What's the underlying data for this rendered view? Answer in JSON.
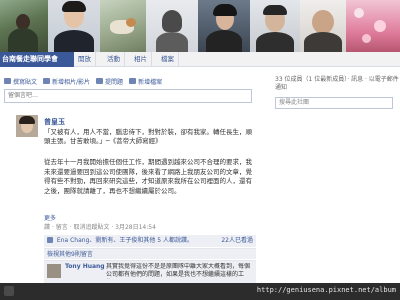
{
  "group": {
    "title": "台南餐走聯同學會"
  },
  "nav": [
    "開放",
    "活動",
    "相片",
    "檔案"
  ],
  "composer": {
    "tabs": [
      "撰寫貼文",
      "新增相片/影片",
      "提問題",
      "新增檔案"
    ],
    "placeholder": "留個言吧…"
  },
  "right": {
    "members_line": "33 位成員（1 位最新成員）· 訊息 · 以電子郵件通知",
    "search_placeholder": "搜尋此社團"
  },
  "post": {
    "author": "曾皇玉",
    "quote": "「又被有人，用人不當，腦忠待下，對對於裝，卻有我家。轉任長生，順頭主張。甘苦敢頃。」─《菩帝大師寫經》",
    "body": "從去年十一月我開始擔任個任工作，期間遇到越來公司不合理的要求，我未來還要過要回到這公司使團隊，後來看了網路上我朋友公司的文章，覺得有些不對勁，再回來研究這些，才知道原來我所在公司裡面的人，還有之後，團隊就請離了，再也不想繼續屬於公司。",
    "more": "更多",
    "meta": "讚 · 留言 · 取消追蹤貼文 · 3月28日14:54",
    "likes": "Ena Chang、劉新有、王子俊和其他 5 人都說讚。",
    "shares": "22人已看過",
    "comments_link": "檢視其他9則留言",
    "commenter": "Tony Huang",
    "comment_text": "其實我覺得這份不是是原團隊中離大家大概看到，每個公司都有他們的問題，如果是我也不想繼續這樣的工作..."
  },
  "statusbar": {
    "url": "http://geniusena.pixnet.net/album"
  }
}
